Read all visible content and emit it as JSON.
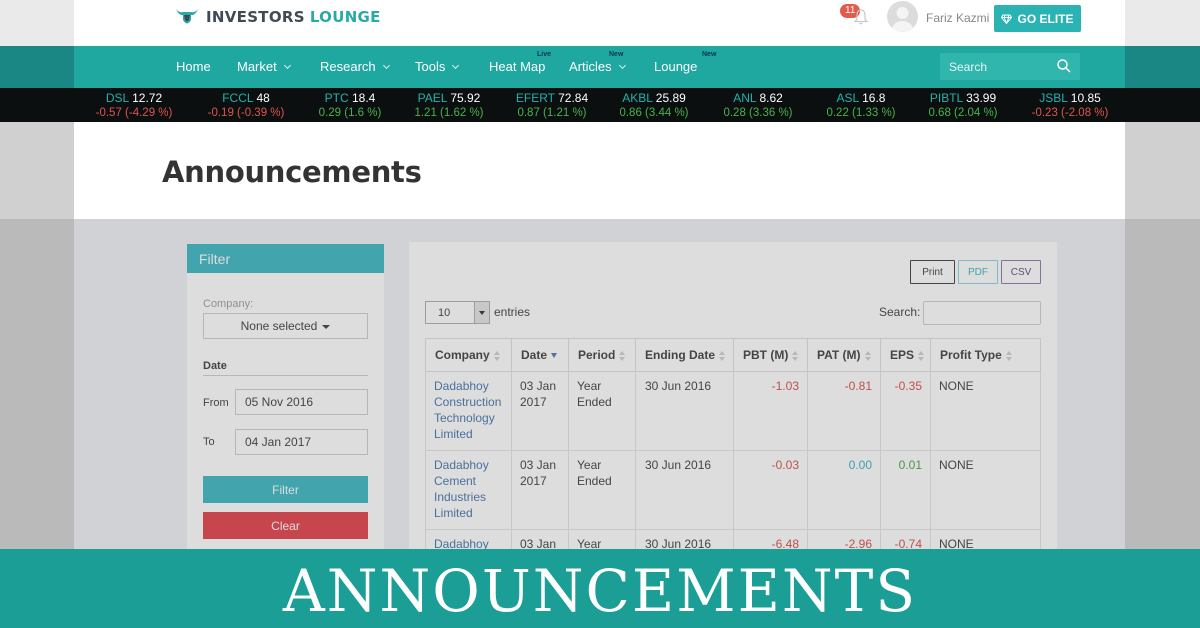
{
  "header": {
    "logo_part1": "INVESTORS",
    "logo_part2": "LOUNGE",
    "notification_count": "11",
    "user_name": "Fariz Kazmi",
    "elite_label": "GO ELITE"
  },
  "nav": {
    "items": [
      {
        "label": "Home",
        "dropdown": false,
        "badge": ""
      },
      {
        "label": "Market",
        "dropdown": true,
        "badge": ""
      },
      {
        "label": "Research",
        "dropdown": true,
        "badge": ""
      },
      {
        "label": "Tools",
        "dropdown": true,
        "badge": ""
      },
      {
        "label": "Heat Map",
        "dropdown": false,
        "badge": "Live"
      },
      {
        "label": "Articles",
        "dropdown": true,
        "badge": "New"
      },
      {
        "label": "Lounge",
        "dropdown": false,
        "badge": "New"
      }
    ],
    "search_placeholder": "Search"
  },
  "ticker": [
    {
      "symbol": "DSL",
      "price": "12.72",
      "change": "-0.57 (-4.29 %)",
      "dir": "neg"
    },
    {
      "symbol": "FCCL",
      "price": "48",
      "change": "-0.19 (-0.39 %)",
      "dir": "neg"
    },
    {
      "symbol": "PTC",
      "price": "18.4",
      "change": "0.29 (1.6 %)",
      "dir": "pos"
    },
    {
      "symbol": "PAEL",
      "price": "75.92",
      "change": "1.21 (1.62 %)",
      "dir": "pos"
    },
    {
      "symbol": "EFERT",
      "price": "72.84",
      "change": "0.87 (1.21 %)",
      "dir": "pos"
    },
    {
      "symbol": "AKBL",
      "price": "25.89",
      "change": "0.86 (3.44 %)",
      "dir": "pos"
    },
    {
      "symbol": "ANL",
      "price": "8.62",
      "change": "0.28 (3.36 %)",
      "dir": "pos"
    },
    {
      "symbol": "ASL",
      "price": "16.8",
      "change": "0.22 (1.33 %)",
      "dir": "pos"
    },
    {
      "symbol": "PIBTL",
      "price": "33.99",
      "change": "0.68 (2.04 %)",
      "dir": "pos"
    },
    {
      "symbol": "JSBL",
      "price": "10.85",
      "change": "-0.23 (-2.08 %)",
      "dir": "neg"
    }
  ],
  "page_title": "Announcements",
  "filter": {
    "title": "Filter",
    "company_label": "Company:",
    "company_value": "None selected",
    "date_label": "Date",
    "from_label": "From",
    "from_value": "05 Nov 2016",
    "to_label": "To",
    "to_value": "04 Jan 2017",
    "filter_button": "Filter",
    "clear_button": "Clear"
  },
  "table_panel": {
    "export_buttons": [
      "Print",
      "PDF",
      "CSV"
    ],
    "entries_value": "10",
    "entries_label": "entries",
    "search_label": "Search:",
    "columns": [
      "Company",
      "Date",
      "Period",
      "Ending Date",
      "PBT (M)",
      "PAT (M)",
      "EPS",
      "Profit Type"
    ],
    "rows": [
      {
        "company": [
          "Dadabhoy",
          "Construction",
          "Technology",
          "Limited"
        ],
        "date": [
          "03 Jan",
          "2017"
        ],
        "period": [
          "Year",
          "Ended"
        ],
        "ending_date": "30 Jun 2016",
        "pbt": "-1.03",
        "pat": "-0.81",
        "eps": "-0.35",
        "profit_type": "NONE"
      },
      {
        "company": [
          "Dadabhoy",
          "Cement",
          "Industries",
          "Limited"
        ],
        "date": [
          "03 Jan",
          "2017"
        ],
        "period": [
          "Year",
          "Ended"
        ],
        "ending_date": "30 Jun 2016",
        "pbt": "-0.03",
        "pat": "0.00",
        "eps": "0.01",
        "profit_type": "NONE"
      },
      {
        "company": [
          "Dadabhoy"
        ],
        "date": [
          "03 Jan"
        ],
        "period": [
          "Year"
        ],
        "ending_date": "30 Jun 2016",
        "pbt": "-6.48",
        "pat": "-2.96",
        "eps": "-0.74",
        "profit_type": "NONE"
      }
    ]
  },
  "banner_text": "ANNOUNCEMENTS",
  "colors": {
    "brand_teal": "#1ea8a0",
    "filter_teal": "#31b3bf",
    "clear_red": "#e2343f",
    "negative": "#e0554a",
    "positive": "#48b44a",
    "banner": "#1a9e96"
  }
}
